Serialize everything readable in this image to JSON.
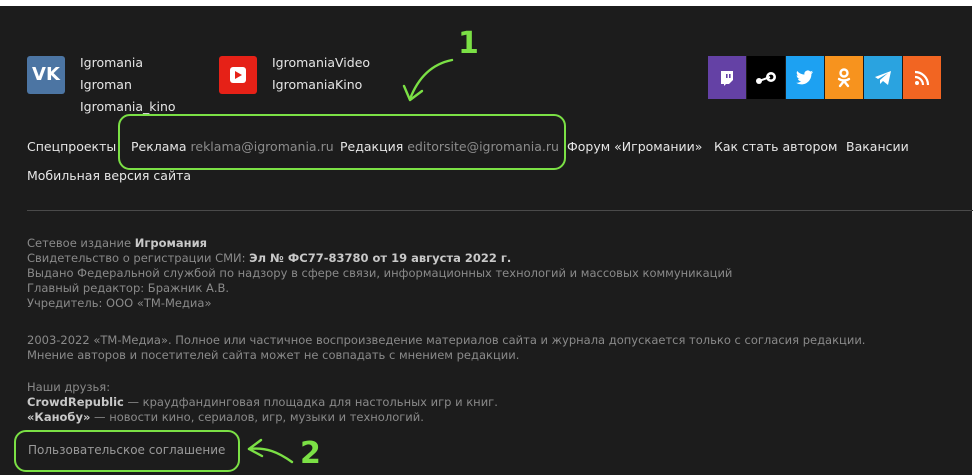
{
  "social_left": {
    "vk": {
      "logo_text": "VK",
      "links": [
        "Igromania",
        "Igroman",
        "Igromania_kino"
      ]
    },
    "youtube": {
      "links": [
        "IgromaniaVideo",
        "IgromaniaKino"
      ]
    }
  },
  "social_right": [
    {
      "name": "twitch",
      "color": "#6441a5",
      "glyph": "◘"
    },
    {
      "name": "steam",
      "color": "#000000",
      "glyph": "⚙"
    },
    {
      "name": "twitter",
      "color": "#1da1f2",
      "glyph": "✦"
    },
    {
      "name": "odnoklassniki",
      "color": "#f7931e",
      "glyph": "ok"
    },
    {
      "name": "telegram",
      "color": "#2aa3e0",
      "glyph": "➤"
    },
    {
      "name": "rss",
      "color": "#f26522",
      "glyph": "◔"
    }
  ],
  "nav": {
    "special": "Спецпроекты",
    "ads_label": "Реклама",
    "ads_email": "reklama@igromania.ru",
    "edit_label": "Редакция",
    "edit_email": "editorsite@igromania.ru",
    "forum": "Форум «Игромании»",
    "author": "Как стать автором",
    "jobs": "Вакансии",
    "mobile": "Мобильная версия сайта"
  },
  "info": {
    "line1_pre": "Сетевое издание ",
    "line1_bold": "Игромания",
    "line2_pre": "Свидетельство о регистрации СМИ: ",
    "line2_bold": "Эл № ФС77-83780 от 19 августа 2022 г.",
    "line3": "Выдано Федеральной службой по надзору в сфере связи, информационных технологий и массовых коммуникаций",
    "line4": "Главный редактор: Бражник А.В.",
    "line5": "Учредитель: ООО «ТМ-Медиа»",
    "copy1": "2003-2022 «ТМ-Медиа». Полное или частичное воспроизведение материалов сайта и журнала допускается только с согласия редакции.",
    "copy2": "Мнение авторов и посетителей сайта может не совпадать с мнением редакции.",
    "friends_title": "Наши друзья:",
    "friend1_bold": "CrowdRepublic",
    "friend1_text": " — краудфандинговая площадка для настольных игр и книг.",
    "friend2_bold": "«Канобу»",
    "friend2_text": " — новости кино, сериалов, игр, музыки и технологий."
  },
  "agreement": "Пользовательское соглашение",
  "annotations": {
    "one": "1",
    "two": "2",
    "color": "#7be045"
  }
}
